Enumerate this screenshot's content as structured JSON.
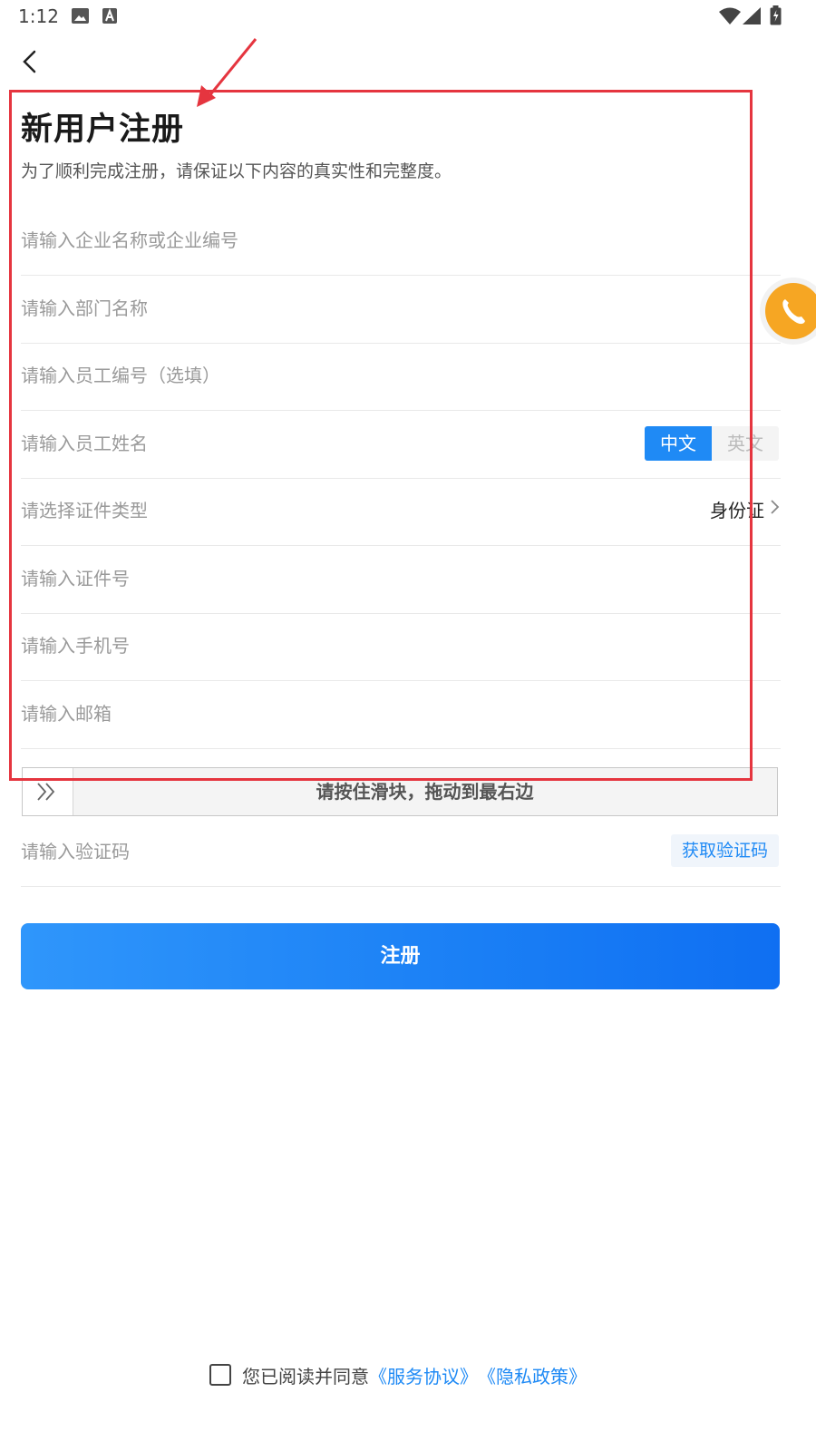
{
  "status_bar": {
    "time": "1:12"
  },
  "form": {
    "title": "新用户注册",
    "subtitle": "为了顺利完成注册，请保证以下内容的真实性和完整度。",
    "company_placeholder": "请输入企业名称或企业编号",
    "department_placeholder": "请输入部门名称",
    "employee_id_placeholder": "请输入员工编号（选填）",
    "employee_name_placeholder": "请输入员工姓名",
    "lang_options": [
      "中文",
      "英文"
    ],
    "lang_selected": "中文",
    "id_type_placeholder": "请选择证件类型",
    "id_type_value": "身份证",
    "id_number_placeholder": "请输入证件号",
    "phone_placeholder": "请输入手机号",
    "email_placeholder": "请输入邮箱",
    "slider_text": "请按住滑块，拖动到最右边",
    "code_placeholder": "请输入验证码",
    "get_code_label": "获取验证码",
    "register_label": "注册"
  },
  "agreement": {
    "text": "您已阅读并同意",
    "service_link": "《服务协议》",
    "privacy_link": "《隐私政策》",
    "checked": false
  },
  "colors": {
    "primary": "#1f8af5",
    "annotation": "#e5353f",
    "call_button": "#f6a623"
  },
  "icons": [
    "image-icon",
    "a-badge-icon",
    "wifi-icon",
    "signal-icon",
    "battery-icon",
    "back-icon",
    "phone-icon",
    "chevron-right-icon",
    "double-chevron-icon"
  ]
}
